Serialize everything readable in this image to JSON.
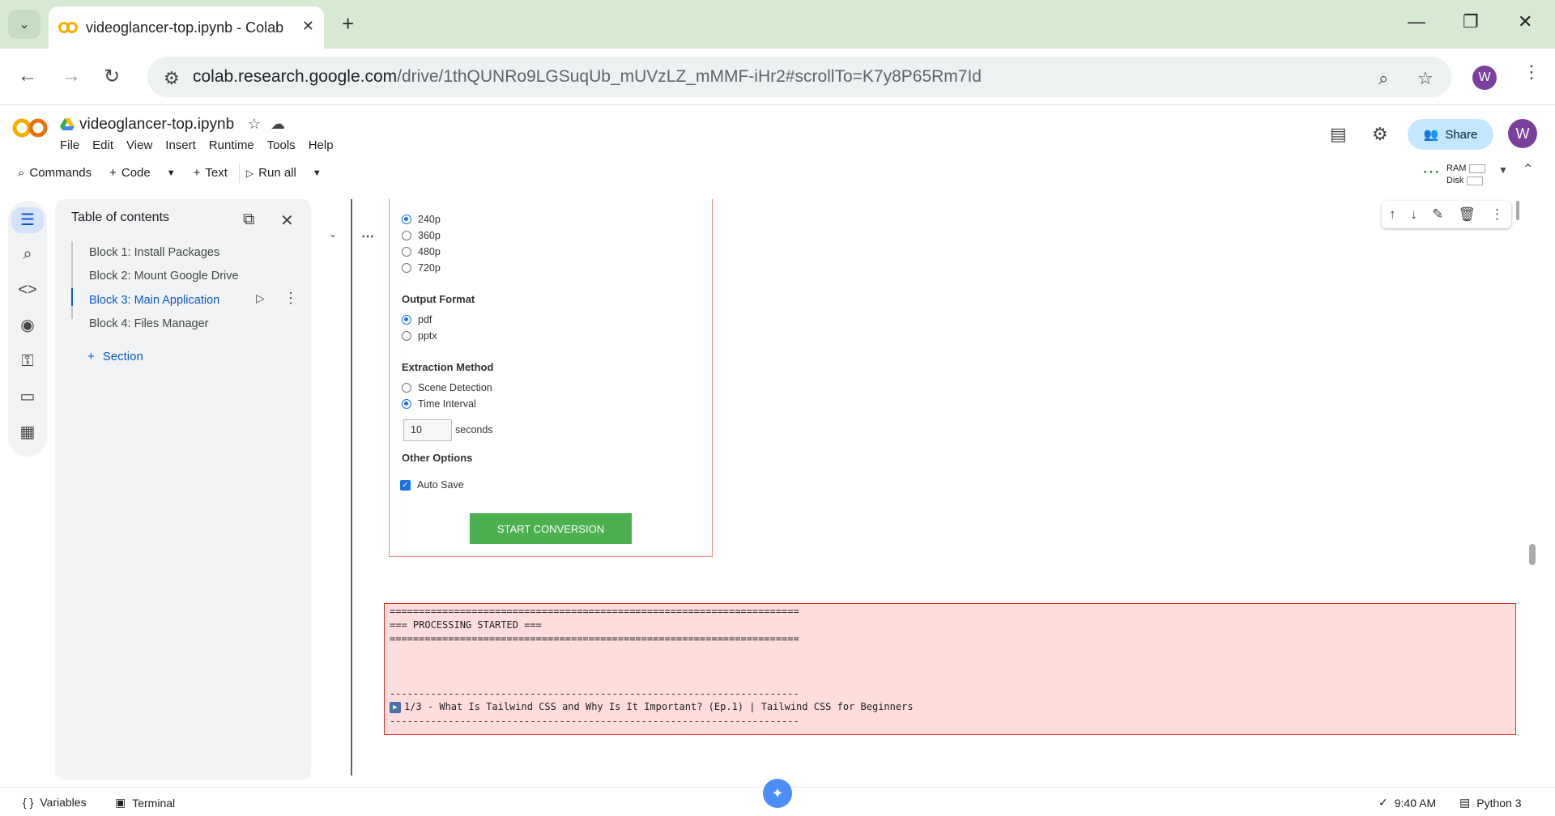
{
  "browser": {
    "tab_title": "videoglancer-top.ipynb - Colab",
    "url_host": "colab.research.google.com",
    "url_path": "/drive/1thQUNRo9LGSuqUb_mUVzLZ_mMMF-iHr2#scrollTo=K7y8P65Rm7Id",
    "profile_initial": "W"
  },
  "colab": {
    "notebook_title": "videoglancer-top.ipynb",
    "menus": [
      "File",
      "Edit",
      "View",
      "Insert",
      "Runtime",
      "Tools",
      "Help"
    ],
    "share_label": "Share",
    "avatar_initial": "W",
    "toolbar": {
      "commands": "Commands",
      "code": "Code",
      "text": "Text",
      "run_all": "Run all"
    },
    "ram_label": "RAM",
    "disk_label": "Disk"
  },
  "toc": {
    "title": "Table of contents",
    "items": [
      {
        "label": "Block 1: Install Packages"
      },
      {
        "label": "Block 2: Mount Google Drive"
      },
      {
        "label": "Block 3: Main Application"
      },
      {
        "label": "Block 4: Files Manager"
      }
    ],
    "add_section": "Section"
  },
  "form": {
    "video_quality": {
      "options": [
        "240p",
        "360p",
        "480p",
        "720p"
      ],
      "selected": "240p"
    },
    "output_format": {
      "label": "Output Format",
      "options": [
        "pdf",
        "pptx"
      ],
      "selected": "pdf"
    },
    "extraction_method": {
      "label": "Extraction Method",
      "options": [
        "Scene Detection",
        "Time Interval"
      ],
      "selected": "Time Interval",
      "interval_value": "10",
      "interval_unit": "seconds"
    },
    "other_options": {
      "label": "Other Options",
      "auto_save_label": "Auto Save",
      "auto_save_checked": true
    },
    "start_button": "START CONVERSION"
  },
  "output": {
    "line1": "======================================================================",
    "line2": "=== PROCESSING STARTED ===",
    "line3": "======================================================================",
    "line4": "----------------------------------------------------------------------",
    "line5": "1/3 - What Is Tailwind CSS and Why Is It Important? (Ep.1) | Tailwind CSS for Beginners",
    "line6": "----------------------------------------------------------------------"
  },
  "status": {
    "variables": "Variables",
    "terminal": "Terminal",
    "time": "9:40 AM",
    "runtime": "Python 3"
  },
  "colors": {
    "accent": "#0b57d0",
    "start_button": "#4caf50",
    "output_bg": "#ffdddd",
    "output_border": "#d93025"
  }
}
